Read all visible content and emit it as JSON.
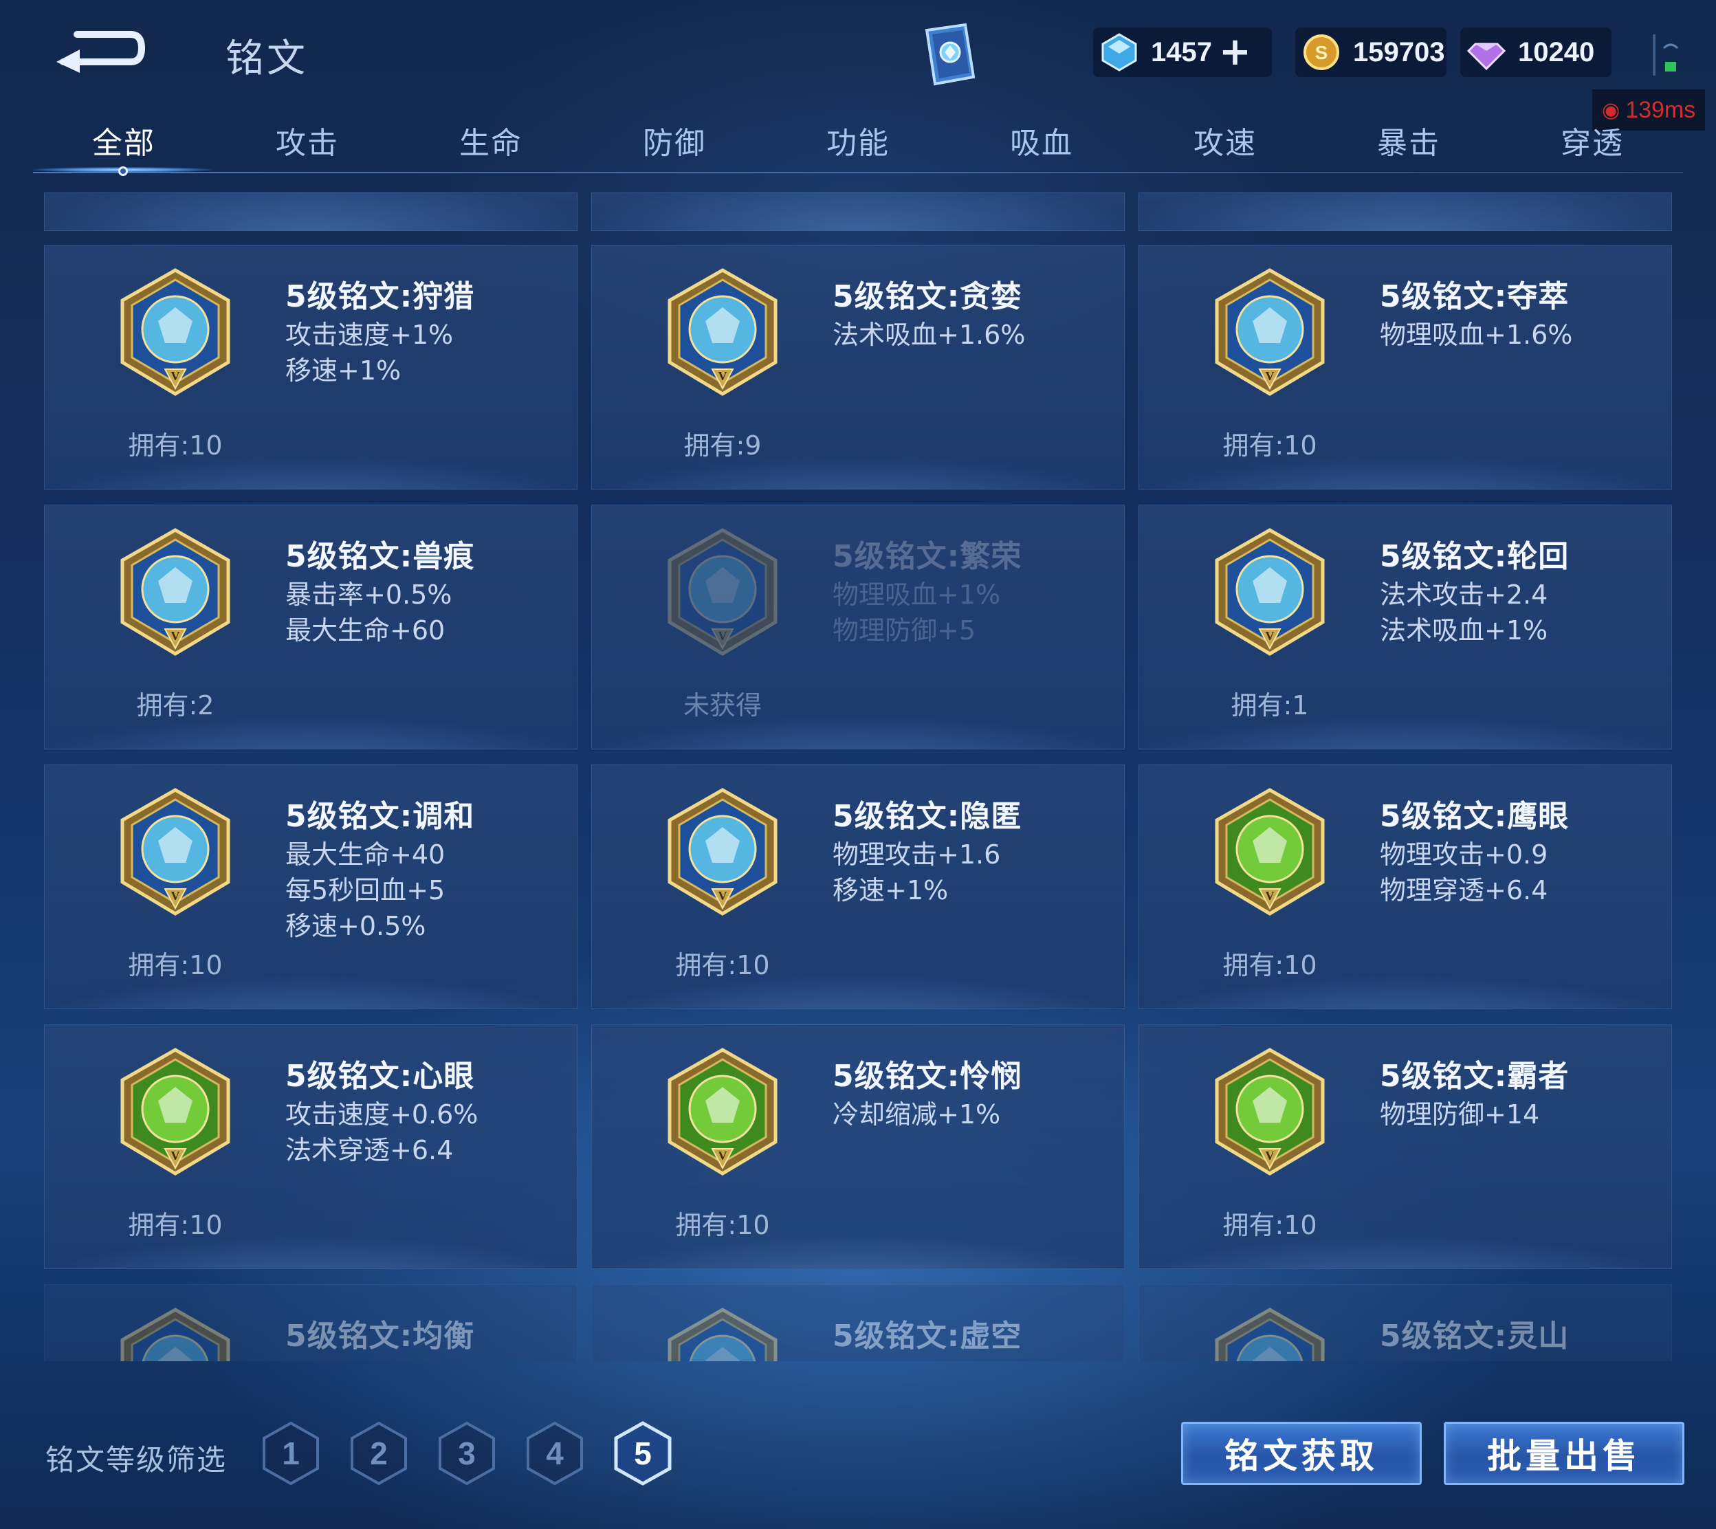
{
  "header": {
    "title": "铭文",
    "currencies": [
      {
        "icon": "crystal-icon",
        "value": "1457",
        "has_plus": true
      },
      {
        "icon": "gold-coin-icon",
        "value": "159703",
        "has_plus": false
      },
      {
        "icon": "diamond-icon",
        "value": "10240",
        "has_plus": false
      }
    ],
    "ping": "139ms"
  },
  "tabs": [
    {
      "label": "全部",
      "active": true
    },
    {
      "label": "攻击",
      "active": false
    },
    {
      "label": "生命",
      "active": false
    },
    {
      "label": "防御",
      "active": false
    },
    {
      "label": "功能",
      "active": false
    },
    {
      "label": "吸血",
      "active": false
    },
    {
      "label": "攻速",
      "active": false
    },
    {
      "label": "暴击",
      "active": false
    },
    {
      "label": "穿透",
      "active": false
    }
  ],
  "runes": [
    {
      "name": "5级铭文:狩猎",
      "stats": [
        "攻击速度+1%",
        "移速+1%"
      ],
      "owned": "拥有:10",
      "color": "#5fc8ee",
      "tier": "blue",
      "dim": false
    },
    {
      "name": "5级铭文:贪婪",
      "stats": [
        "法术吸血+1.6%"
      ],
      "owned": "拥有:9",
      "color": "#5fc8ee",
      "tier": "blue",
      "dim": false
    },
    {
      "name": "5级铭文:夺萃",
      "stats": [
        "物理吸血+1.6%"
      ],
      "owned": "拥有:10",
      "color": "#5fc8ee",
      "tier": "blue",
      "dim": false
    },
    {
      "name": "5级铭文:兽痕",
      "stats": [
        "暴击率+0.5%",
        "最大生命+60"
      ],
      "owned": "拥有:2",
      "color": "#5fc8ee",
      "tier": "blue",
      "dim": false
    },
    {
      "name": "5级铭文:繁荣",
      "stats": [
        "物理吸血+1%",
        "物理防御+5"
      ],
      "owned": "未获得",
      "color": "#5fc8ee",
      "tier": "blue",
      "dim": true
    },
    {
      "name": "5级铭文:轮回",
      "stats": [
        "法术攻击+2.4",
        "法术吸血+1%"
      ],
      "owned": "拥有:1",
      "color": "#5fc8ee",
      "tier": "blue",
      "dim": false
    },
    {
      "name": "5级铭文:调和",
      "stats": [
        "最大生命+40",
        "每5秒回血+5",
        "移速+0.5%"
      ],
      "owned": "拥有:10",
      "color": "#5fc8ee",
      "tier": "blue",
      "dim": false
    },
    {
      "name": "5级铭文:隐匿",
      "stats": [
        "物理攻击+1.6",
        "移速+1%"
      ],
      "owned": "拥有:10",
      "color": "#5fc8ee",
      "tier": "blue",
      "dim": false
    },
    {
      "name": "5级铭文:鹰眼",
      "stats": [
        "物理攻击+0.9",
        "物理穿透+6.4"
      ],
      "owned": "拥有:10",
      "color": "#7ed640",
      "tier": "green",
      "dim": false
    },
    {
      "name": "5级铭文:心眼",
      "stats": [
        "攻击速度+0.6%",
        "法术穿透+6.4"
      ],
      "owned": "拥有:10",
      "color": "#7ed640",
      "tier": "green",
      "dim": false
    },
    {
      "name": "5级铭文:怜悯",
      "stats": [
        "冷却缩减+1%"
      ],
      "owned": "拥有:10",
      "color": "#7ed640",
      "tier": "green",
      "dim": false
    },
    {
      "name": "5级铭文:霸者",
      "stats": [
        "物理防御+14"
      ],
      "owned": "拥有:10",
      "color": "#7ed640",
      "tier": "green",
      "dim": false
    }
  ],
  "partial_runes": [
    "5级铭文:均衡",
    "5级铭文:虚空",
    "5级铭文:灵山"
  ],
  "footer": {
    "filter_label": "铭文等级筛选",
    "levels": [
      "1",
      "2",
      "3",
      "4",
      "5"
    ],
    "active_level": "5",
    "obtain_button": "铭文获取",
    "sell_button": "批量出售"
  }
}
